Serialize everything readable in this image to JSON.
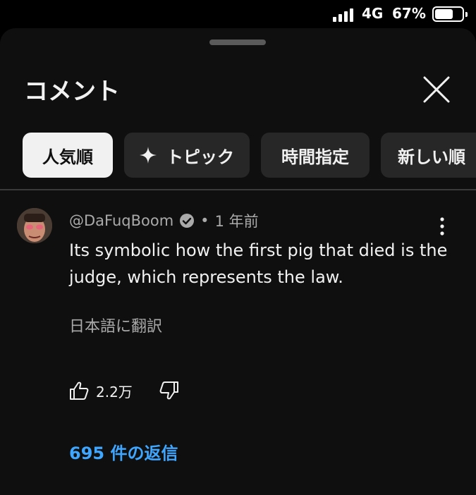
{
  "status_bar": {
    "network": "4G",
    "battery_percent": "67%",
    "battery_level": 0.67
  },
  "sheet": {
    "title": "コメント",
    "filters": [
      {
        "label": "人気順",
        "active": true
      },
      {
        "label": "トピック",
        "icon": "sparkle-icon"
      },
      {
        "label": "時間指定"
      },
      {
        "label": "新しい順"
      }
    ]
  },
  "comment": {
    "author": "@DaFuqBoom",
    "verified": true,
    "separator": "•",
    "time": "1 年前",
    "text": "Its symbolic how the first pig that died is the judge, which represents the law.",
    "translate_label": "日本語に翻訳",
    "likes": "2.2万",
    "replies_label": "695 件の返信"
  },
  "colors": {
    "accent": "#3ea6ff",
    "background": "#0f0f0f",
    "chip": "#272727"
  }
}
